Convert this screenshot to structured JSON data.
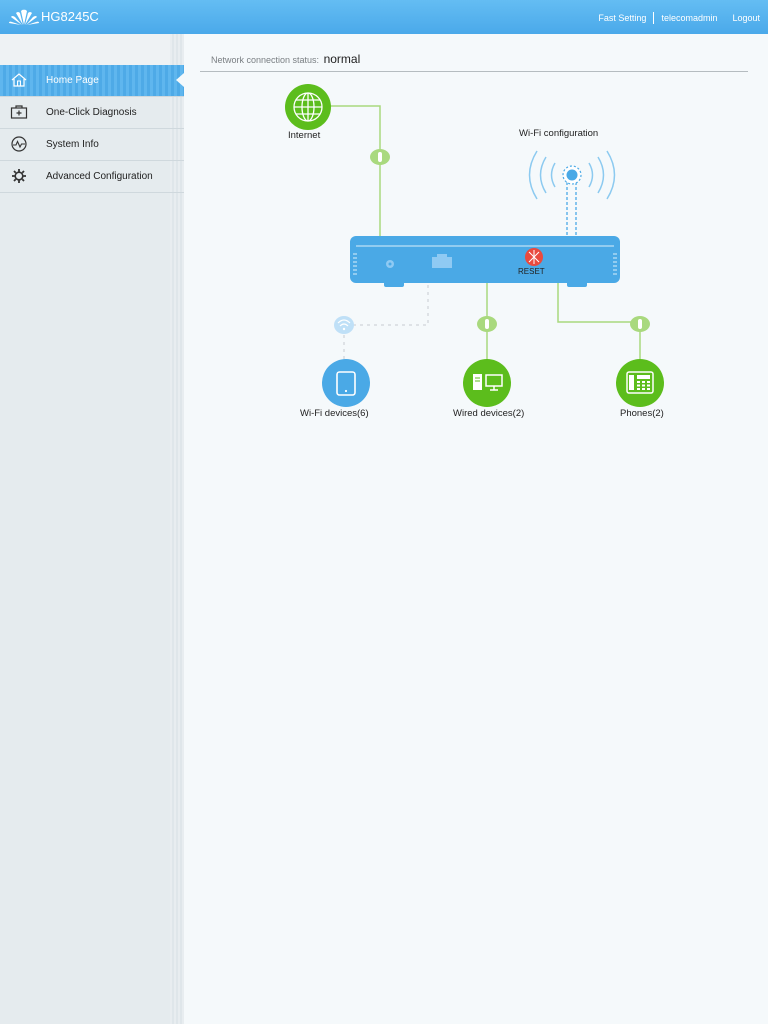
{
  "header": {
    "brand": "HG8245C",
    "links": {
      "fast_setting": "Fast Setting",
      "user": "telecomadmin",
      "logout": "Logout"
    }
  },
  "sidebar": {
    "items": [
      {
        "label": "Home Page",
        "icon": "home-icon",
        "active": true
      },
      {
        "label": "One-Click Diagnosis",
        "icon": "medkit-icon",
        "active": false
      },
      {
        "label": "System Info",
        "icon": "pulse-icon",
        "active": false
      },
      {
        "label": "Advanced Configuration",
        "icon": "gear-icon",
        "active": false
      }
    ]
  },
  "status": {
    "label": "Network connection status:",
    "value": "normal"
  },
  "diagram": {
    "internet_label": "Internet",
    "wifi_config_label": "Wi-Fi configuration",
    "reset_label": "RESET",
    "wifi_devices_label": "Wi-Fi devices(6)",
    "wired_devices_label": "Wired devices(2)",
    "phones_label": "Phones(2)"
  },
  "colors": {
    "header_blue": "#4aa9ea",
    "router_blue": "#4aa9e6",
    "green": "#5cbd1c",
    "line_green": "#a9d97e",
    "reset_red": "#e94a3f"
  }
}
